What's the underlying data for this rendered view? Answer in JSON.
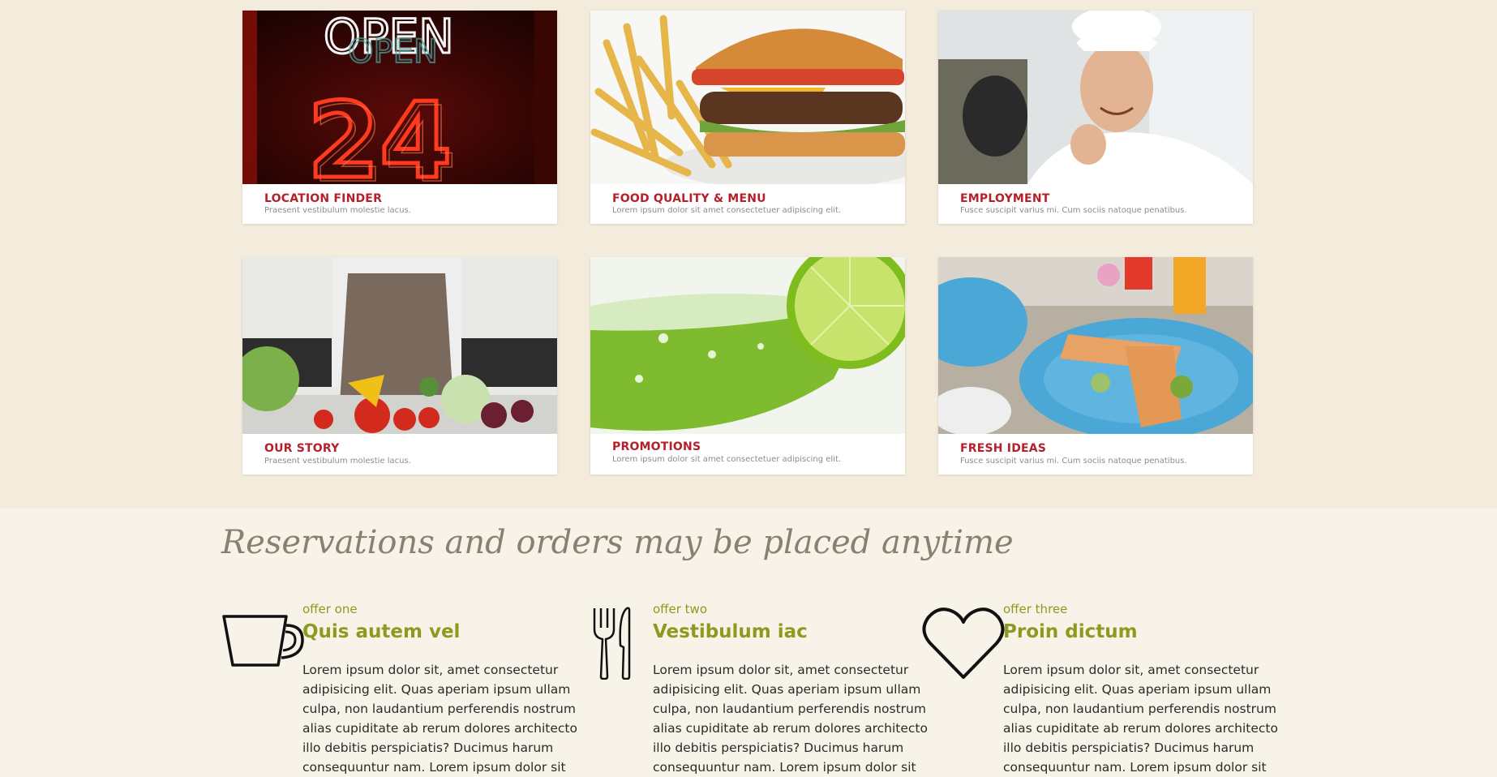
{
  "tiles": [
    {
      "title": "LOCATION FINDER",
      "subtitle": "Praesent vestibulum molestie lacus.",
      "image": "open-24-neon-sign"
    },
    {
      "title": "FOOD QUALITY & MENU",
      "subtitle": "Lorem ipsum dolor sit amet consectetuer adipiscing elit.",
      "image": "burger-and-fries"
    },
    {
      "title": "EMPLOYMENT",
      "subtitle": "Fusce suscipit varius mi. Cum sociis natoque penatibus.",
      "image": "smiling-chef"
    },
    {
      "title": "OUR STORY",
      "subtitle": "Praesent vestibulum molestie lacus.",
      "image": "chef-with-vegetables"
    },
    {
      "title": "PROMOTIONS",
      "subtitle": "Lorem ipsum dolor sit amet consectetuer adipiscing elit.",
      "image": "lime-drink"
    },
    {
      "title": "FRESH IDEAS",
      "subtitle": "Fusce suscipit varius mi. Cum sociis natoque penatibus.",
      "image": "plated-dish"
    }
  ],
  "reservations": {
    "title": "Reservations and orders may be placed anytime"
  },
  "offers": [
    {
      "eyebrow": "offer one",
      "heading": "Quis autem vel",
      "icon": "coffee-cup-icon",
      "body": "Lorem ipsum dolor sit, amet consectetur adipisicing elit. Quas aperiam ipsum ullam culpa, non laudantium perferendis nostrum alias cupiditate ab rerum dolores architecto illo debitis perspiciatis? Ducimus harum consequuntur nam. Lorem ipsum dolor sit"
    },
    {
      "eyebrow": "offer two",
      "heading": "Vestibulum iac",
      "icon": "fork-knife-icon",
      "body": "Lorem ipsum dolor sit, amet consectetur adipisicing elit. Quas aperiam ipsum ullam culpa, non laudantium perferendis nostrum alias cupiditate ab rerum dolores architecto illo debitis perspiciatis? Ducimus harum consequuntur nam. Lorem ipsum dolor sit"
    },
    {
      "eyebrow": "offer three",
      "heading": "Proin dictum",
      "icon": "heart-icon",
      "body": "Lorem ipsum dolor sit, amet consectetur adipisicing elit. Quas aperiam ipsum ullam culpa, non laudantium perferendis nostrum alias cupiditate ab rerum dolores architecto illo debitis perspiciatis? Ducimus harum consequuntur nam. Lorem ipsum dolor sit"
    }
  ],
  "colors": {
    "top_band": "#f3ecdc",
    "page_bg": "#f8f3e8",
    "caption_red": "#b5202a",
    "accent_olive": "#8c9a1f",
    "title_taupe": "#8b8070"
  }
}
